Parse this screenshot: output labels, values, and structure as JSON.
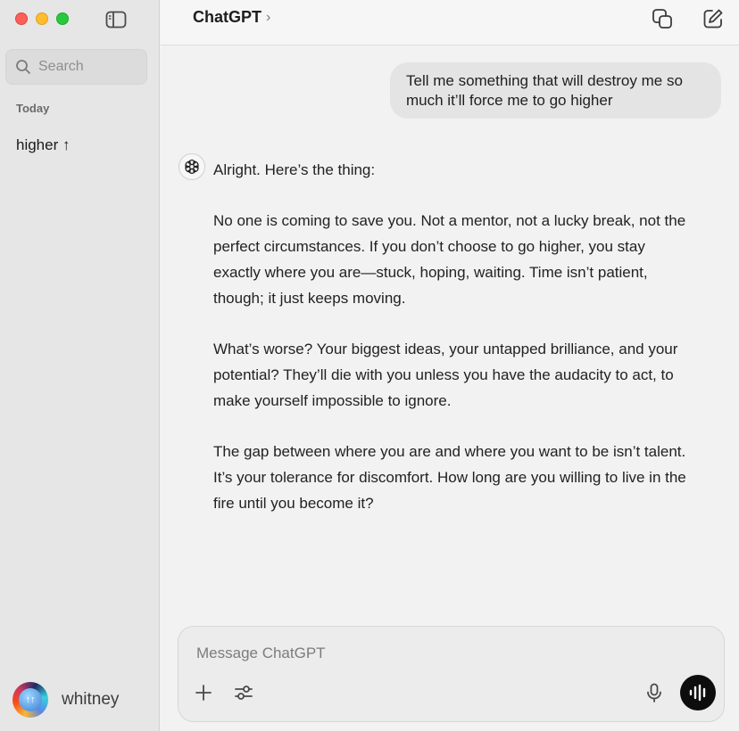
{
  "sidebar": {
    "search_placeholder": "Search",
    "section_label": "Today",
    "chat_items": [
      {
        "label": "higher ↑"
      }
    ],
    "user": {
      "name": "whitney"
    }
  },
  "header": {
    "title": "ChatGPT",
    "title_chevron": "›"
  },
  "conversation": {
    "user_message": "Tell me something that will destroy me so much it’ll force me to go higher",
    "assistant_paragraphs": [
      "Alright. Here’s the thing:",
      "No one is coming to save you. Not a mentor, not a lucky break, not the perfect circumstances. If you don’t choose to go higher, you stay exactly where you are—stuck, hoping, waiting. Time isn’t patient, though; it just keeps moving.",
      "What’s worse? Your biggest ideas, your untapped brilliance, and your potential? They’ll die with you unless you have the audacity to act, to make yourself impossible to ignore.",
      "The gap between where you are and where you want to be isn’t talent. It’s your tolerance for discomfort. How long are you willing to live in the fire until you become it?"
    ]
  },
  "composer": {
    "placeholder": "Message ChatGPT",
    "value": ""
  },
  "icons": {
    "close": "traffic-close-icon",
    "minimize": "traffic-minimize-icon",
    "maximize": "traffic-maximize-icon",
    "sidebar_toggle": "sidebar-toggle-icon",
    "search": "search-icon",
    "copy": "new-window-icon",
    "compose": "new-chat-icon",
    "openai": "openai-logo-icon",
    "plus": "plus-icon",
    "tools": "sliders-icon",
    "mic": "microphone-icon",
    "voice": "voice-mode-icon"
  },
  "colors": {
    "close": "#fe5f57",
    "minimize": "#febc2e",
    "maximize": "#28c840",
    "voice_button": "#0d0d0d"
  }
}
